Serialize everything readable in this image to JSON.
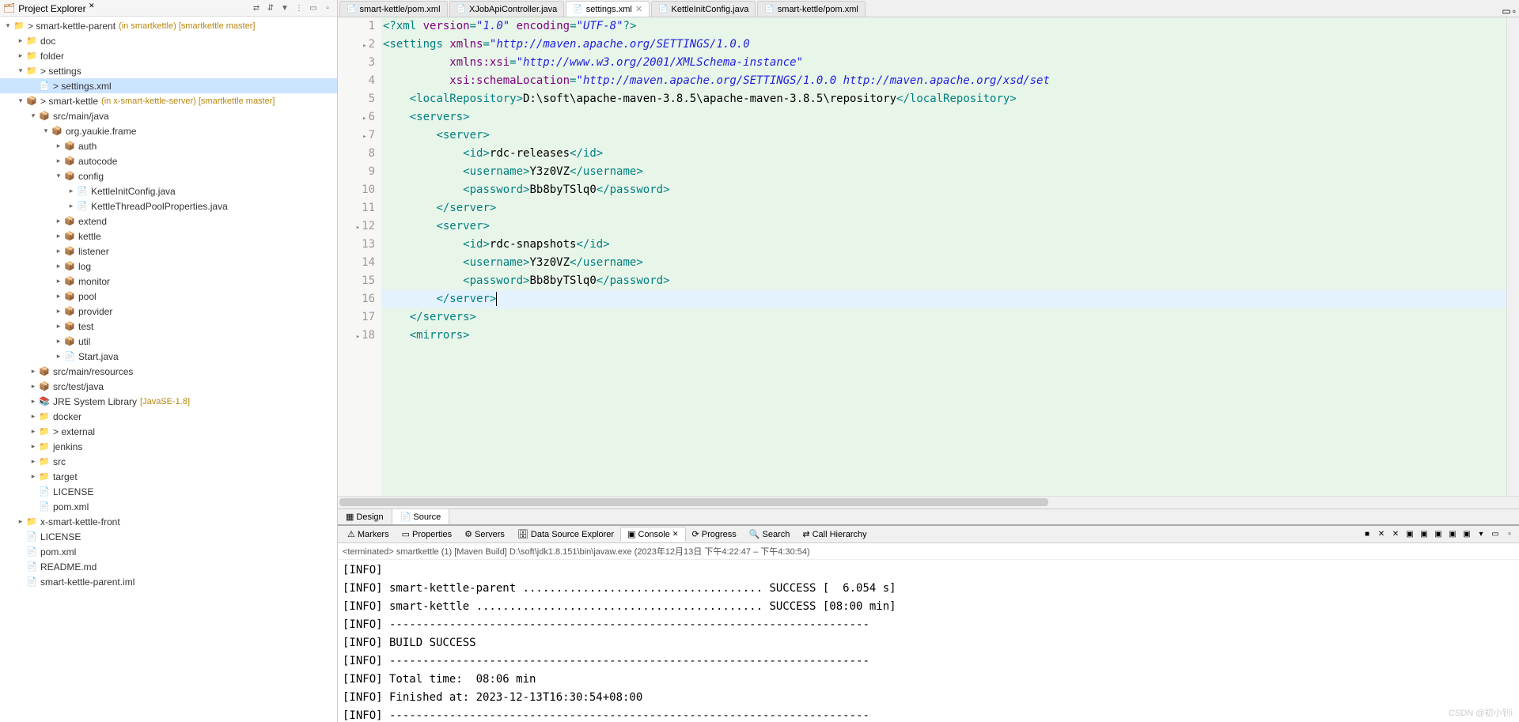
{
  "project_explorer": {
    "title": "Project Explorer",
    "tree": [
      {
        "indent": 0,
        "arrow": "▾",
        "icon": "📁",
        "iconClass": "folder-icon",
        "label": "> smart-kettle-parent",
        "annot": "(in smartkettle) [smartkettle master]"
      },
      {
        "indent": 1,
        "arrow": "▸",
        "icon": "📁",
        "iconClass": "folder-icon",
        "label": "doc"
      },
      {
        "indent": 1,
        "arrow": "▸",
        "icon": "📁",
        "iconClass": "folder-icon",
        "label": "folder"
      },
      {
        "indent": 1,
        "arrow": "▾",
        "icon": "📁",
        "iconClass": "folder-icon",
        "label": "> settings"
      },
      {
        "indent": 2,
        "arrow": "",
        "icon": "📄",
        "iconClass": "file-icon",
        "label": "> settings.xml",
        "selected": true
      },
      {
        "indent": 1,
        "arrow": "▾",
        "icon": "📦",
        "iconClass": "pkg-icon",
        "label": "> smart-kettle",
        "annot": "(in x-smart-kettle-server) [smartkettle master]"
      },
      {
        "indent": 2,
        "arrow": "▾",
        "icon": "📦",
        "iconClass": "pkg-icon",
        "label": "src/main/java"
      },
      {
        "indent": 3,
        "arrow": "▾",
        "icon": "📦",
        "iconClass": "pkg-icon",
        "label": "org.yaukie.frame"
      },
      {
        "indent": 4,
        "arrow": "▸",
        "icon": "📦",
        "iconClass": "pkg-icon",
        "label": "auth"
      },
      {
        "indent": 4,
        "arrow": "▸",
        "icon": "📦",
        "iconClass": "pkg-icon",
        "label": "autocode"
      },
      {
        "indent": 4,
        "arrow": "▾",
        "icon": "📦",
        "iconClass": "pkg-icon",
        "label": "config"
      },
      {
        "indent": 5,
        "arrow": "▸",
        "icon": "📄",
        "iconClass": "java-icon",
        "label": "KettleInitConfig.java"
      },
      {
        "indent": 5,
        "arrow": "▸",
        "icon": "📄",
        "iconClass": "java-icon",
        "label": "KettleThreadPoolProperties.java"
      },
      {
        "indent": 4,
        "arrow": "▸",
        "icon": "📦",
        "iconClass": "pkg-icon",
        "label": "extend"
      },
      {
        "indent": 4,
        "arrow": "▸",
        "icon": "📦",
        "iconClass": "pkg-icon",
        "label": "kettle"
      },
      {
        "indent": 4,
        "arrow": "▸",
        "icon": "📦",
        "iconClass": "pkg-icon",
        "label": "listener"
      },
      {
        "indent": 4,
        "arrow": "▸",
        "icon": "📦",
        "iconClass": "pkg-icon",
        "label": "log"
      },
      {
        "indent": 4,
        "arrow": "▸",
        "icon": "📦",
        "iconClass": "pkg-icon",
        "label": "monitor"
      },
      {
        "indent": 4,
        "arrow": "▸",
        "icon": "📦",
        "iconClass": "pkg-icon",
        "label": "pool"
      },
      {
        "indent": 4,
        "arrow": "▸",
        "icon": "📦",
        "iconClass": "pkg-icon",
        "label": "provider"
      },
      {
        "indent": 4,
        "arrow": "▸",
        "icon": "📦",
        "iconClass": "pkg-icon",
        "label": "test"
      },
      {
        "indent": 4,
        "arrow": "▸",
        "icon": "📦",
        "iconClass": "pkg-icon",
        "label": "util"
      },
      {
        "indent": 4,
        "arrow": "▸",
        "icon": "📄",
        "iconClass": "java-icon",
        "label": "Start.java"
      },
      {
        "indent": 2,
        "arrow": "▸",
        "icon": "📦",
        "iconClass": "pkg-icon",
        "label": "src/main/resources"
      },
      {
        "indent": 2,
        "arrow": "▸",
        "icon": "📦",
        "iconClass": "pkg-icon",
        "label": "src/test/java"
      },
      {
        "indent": 2,
        "arrow": "▸",
        "icon": "📚",
        "iconClass": "lib-icon",
        "label": "JRE System Library",
        "annot": "[JavaSE-1.8]"
      },
      {
        "indent": 2,
        "arrow": "▸",
        "icon": "📁",
        "iconClass": "folder-icon",
        "label": "docker"
      },
      {
        "indent": 2,
        "arrow": "▸",
        "icon": "📁",
        "iconClass": "folder-icon",
        "label": "> external"
      },
      {
        "indent": 2,
        "arrow": "▸",
        "icon": "📁",
        "iconClass": "folder-icon",
        "label": "jenkins"
      },
      {
        "indent": 2,
        "arrow": "▸",
        "icon": "📁",
        "iconClass": "folder-icon",
        "label": "src"
      },
      {
        "indent": 2,
        "arrow": "▸",
        "icon": "📁",
        "iconClass": "folder-icon",
        "label": "target"
      },
      {
        "indent": 2,
        "arrow": "",
        "icon": "📄",
        "iconClass": "file-icon",
        "label": "LICENSE"
      },
      {
        "indent": 2,
        "arrow": "",
        "icon": "📄",
        "iconClass": "file-icon",
        "label": "pom.xml"
      },
      {
        "indent": 1,
        "arrow": "▸",
        "icon": "📁",
        "iconClass": "folder-icon",
        "label": "x-smart-kettle-front"
      },
      {
        "indent": 1,
        "arrow": "",
        "icon": "📄",
        "iconClass": "file-icon",
        "label": "LICENSE"
      },
      {
        "indent": 1,
        "arrow": "",
        "icon": "📄",
        "iconClass": "file-icon",
        "label": "pom.xml"
      },
      {
        "indent": 1,
        "arrow": "",
        "icon": "📄",
        "iconClass": "file-icon",
        "label": "README.md"
      },
      {
        "indent": 1,
        "arrow": "",
        "icon": "📄",
        "iconClass": "file-icon",
        "label": "smart-kettle-parent.iml"
      }
    ]
  },
  "editor_tabs": [
    {
      "label": "smart-kettle/pom.xml",
      "icon": "📄"
    },
    {
      "label": "XJobApiController.java",
      "icon": "📄"
    },
    {
      "label": "settings.xml",
      "icon": "📄",
      "active": true
    },
    {
      "label": "KettleInitConfig.java",
      "icon": "📄"
    },
    {
      "label": "smart-kettle/pom.xml",
      "icon": "📄"
    }
  ],
  "code_lines": [
    {
      "n": 1,
      "html": "<span class='punct'>&lt;?</span><span class='tag'>xml</span> <span class='attr'>version</span><span class='punct'>=</span><span class='str'>\"1.0\"</span> <span class='attr'>encoding</span><span class='punct'>=</span><span class='str'>\"UTF-8\"</span><span class='punct'>?&gt;</span>"
    },
    {
      "n": 2,
      "marker": true,
      "html": "<span class='punct'>&lt;</span><span class='tag'>settings</span> <span class='attr'>xmlns</span><span class='punct'>=</span><span class='str'>\"http://maven.apache.org/SETTINGS/1.0.0</span>"
    },
    {
      "n": 3,
      "html": "          <span class='attr'>xmlns:xsi</span><span class='punct'>=</span><span class='str'>\"http://www.w3.org/2001/XMLSchema-instance\"</span>"
    },
    {
      "n": 4,
      "html": "          <span class='attr'>xsi:schemaLocation</span><span class='punct'>=</span><span class='str'>\"http://maven.apache.org/SETTINGS/1.0.0 http://maven.apache.org/xsd/set</span>"
    },
    {
      "n": 5,
      "html": "    <span class='punct'>&lt;</span><span class='tag'>localRepository</span><span class='punct'>&gt;</span><span class='text'>D:\\soft\\apache-maven-3.8.5\\apache-maven-3.8.5\\repository</span><span class='punct'>&lt;/</span><span class='tag'>localRepository</span><span class='punct'>&gt;</span>"
    },
    {
      "n": 6,
      "marker": true,
      "html": "    <span class='punct'>&lt;</span><span class='tag'>servers</span><span class='punct'>&gt;</span>"
    },
    {
      "n": 7,
      "marker": true,
      "html": "        <span class='punct'>&lt;</span><span class='tag'>server</span><span class='punct'>&gt;</span>"
    },
    {
      "n": 8,
      "html": "            <span class='punct'>&lt;</span><span class='tag'>id</span><span class='punct'>&gt;</span><span class='text'>rdc-releases</span><span class='punct'>&lt;/</span><span class='tag'>id</span><span class='punct'>&gt;</span>"
    },
    {
      "n": 9,
      "html": "            <span class='punct'>&lt;</span><span class='tag'>username</span><span class='punct'>&gt;</span><span class='text'>Y3z0VZ</span><span class='punct'>&lt;/</span><span class='tag'>username</span><span class='punct'>&gt;</span>"
    },
    {
      "n": 10,
      "html": "            <span class='punct'>&lt;</span><span class='tag'>password</span><span class='punct'>&gt;</span><span class='text'>Bb8byTSlq0</span><span class='punct'>&lt;/</span><span class='tag'>password</span><span class='punct'>&gt;</span>"
    },
    {
      "n": 11,
      "html": "        <span class='punct'>&lt;/</span><span class='tag'>server</span><span class='punct'>&gt;</span>"
    },
    {
      "n": 12,
      "marker": true,
      "html": "        <span class='punct'>&lt;</span><span class='tag'>server</span><span class='punct'>&gt;</span>"
    },
    {
      "n": 13,
      "html": "            <span class='punct'>&lt;</span><span class='tag'>id</span><span class='punct'>&gt;</span><span class='text'>rdc-snapshots</span><span class='punct'>&lt;/</span><span class='tag'>id</span><span class='punct'>&gt;</span>"
    },
    {
      "n": 14,
      "html": "            <span class='punct'>&lt;</span><span class='tag'>username</span><span class='punct'>&gt;</span><span class='text'>Y3z0VZ</span><span class='punct'>&lt;/</span><span class='tag'>username</span><span class='punct'>&gt;</span>"
    },
    {
      "n": 15,
      "html": "            <span class='punct'>&lt;</span><span class='tag'>password</span><span class='punct'>&gt;</span><span class='text'>Bb8byTSlq0</span><span class='punct'>&lt;/</span><span class='tag'>password</span><span class='punct'>&gt;</span>"
    },
    {
      "n": 16,
      "current": true,
      "html": "        <span class='punct'>&lt;/</span><span class='tag'>server</span><span class='punct'>&gt;</span><span class='caret'></span>"
    },
    {
      "n": 17,
      "html": "    <span class='punct'>&lt;/</span><span class='tag'>servers</span><span class='punct'>&gt;</span>"
    },
    {
      "n": 18,
      "marker": true,
      "html": "    <span class='punct'>&lt;</span><span class='tag'>mirrors</span><span class='punct'>&gt;</span>"
    }
  ],
  "mode_tabs": {
    "design": "Design",
    "source": "Source"
  },
  "bottom_tabs": [
    {
      "label": "Markers",
      "icon": "⚠"
    },
    {
      "label": "Properties",
      "icon": "▭"
    },
    {
      "label": "Servers",
      "icon": "⚙"
    },
    {
      "label": "Data Source Explorer",
      "icon": "🗄"
    },
    {
      "label": "Console",
      "icon": "▣",
      "active": true
    },
    {
      "label": "Progress",
      "icon": "⟳"
    },
    {
      "label": "Search",
      "icon": "🔍"
    },
    {
      "label": "Call Hierarchy",
      "icon": "⇄"
    }
  ],
  "console": {
    "header": "<terminated> smartkettle (1) [Maven Build] D:\\soft\\jdk1.8.151\\bin\\javaw.exe (2023年12月13日 下午4:22:47 – 下午4:30:54)",
    "lines": [
      "[INFO]",
      "[INFO] smart-kettle-parent .................................... SUCCESS [  6.054 s]",
      "[INFO] smart-kettle ........................................... SUCCESS [08:00 min]",
      "[INFO] ------------------------------------------------------------------------",
      "[INFO] BUILD SUCCESS",
      "[INFO] ------------------------------------------------------------------------",
      "[INFO] Total time:  08:06 min",
      "[INFO] Finished at: 2023-12-13T16:30:54+08:00",
      "[INFO] ------------------------------------------------------------------------"
    ]
  },
  "watermark": "CSDN @初小钊i"
}
